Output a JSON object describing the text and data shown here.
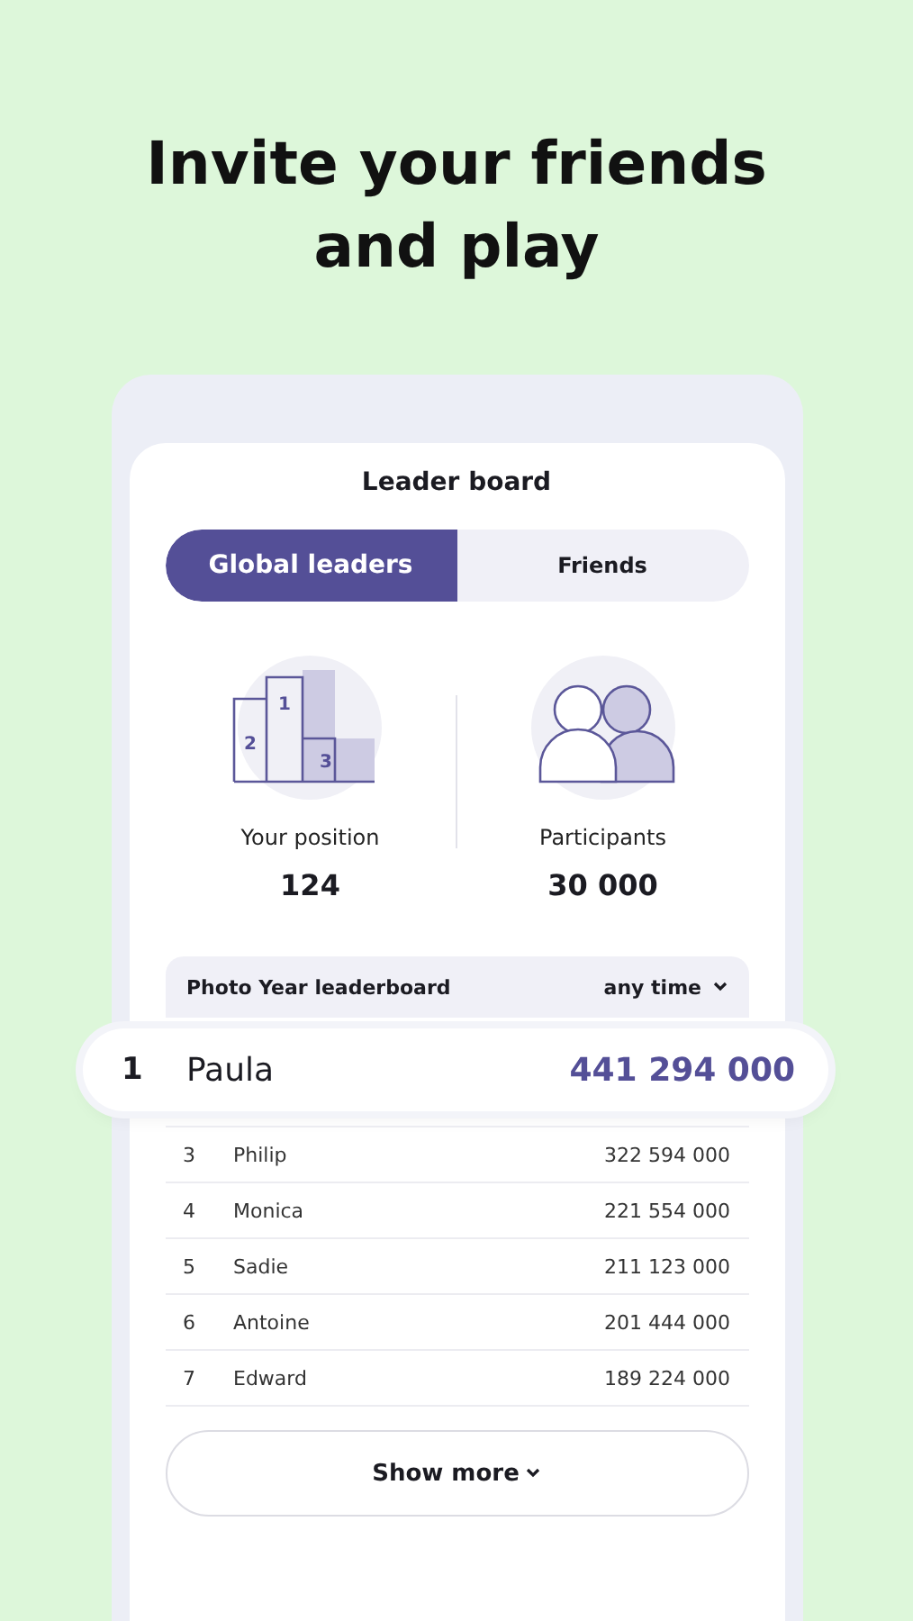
{
  "headline": "Invite your friends and play",
  "card": {
    "title": "Leader board"
  },
  "tabs": [
    {
      "label": "Global leaders",
      "selected": true
    },
    {
      "label": "Friends",
      "selected": false
    }
  ],
  "stats": [
    {
      "kind": "podium",
      "label": "Your position",
      "value": "124",
      "places": [
        "1",
        "2",
        "3"
      ]
    },
    {
      "kind": "people",
      "label": "Participants",
      "value": "30 000"
    }
  ],
  "board": {
    "title": "Photo Year leaderboard",
    "period": "any time"
  },
  "highlight": {
    "rank": "1",
    "name": "Paula",
    "score": "441 294 000"
  },
  "rows": [
    {
      "rank": "3",
      "name": "Philip",
      "score": "322 594 000"
    },
    {
      "rank": "4",
      "name": "Monica",
      "score": "221 554 000"
    },
    {
      "rank": "5",
      "name": "Sadie",
      "score": "211 123 000"
    },
    {
      "rank": "6",
      "name": "Antoine",
      "score": "201 444 000"
    },
    {
      "rank": "7",
      "name": "Edward",
      "score": "189 224 000"
    }
  ],
  "show_more": "Show more"
}
